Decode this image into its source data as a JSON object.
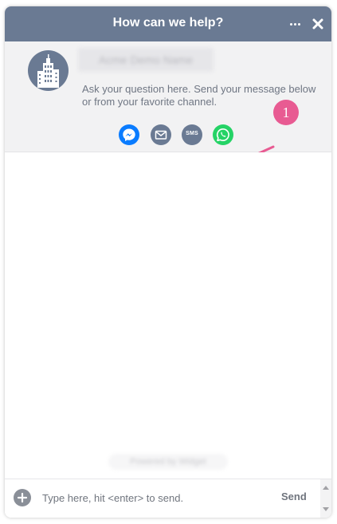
{
  "header": {
    "title": "How can we help?",
    "more_icon": "more-horizontal-icon",
    "close_icon": "close-icon",
    "color": "#6a7a93"
  },
  "intro": {
    "company_name": "Acme Demo Name",
    "avatar_icon": "building-icon",
    "message": "Ask your question here. Send your message below or from your favorite channel."
  },
  "channels": [
    {
      "name": "Messenger",
      "icon": "messenger-icon",
      "color": "#0a7cff"
    },
    {
      "name": "Email",
      "icon": "email-icon",
      "color": "#6a7a93"
    },
    {
      "name": "SMS",
      "icon": "sms-icon",
      "label": "SMS",
      "color": "#6a7a93"
    },
    {
      "name": "WhatsApp",
      "icon": "whatsapp-icon",
      "color": "#25d366"
    }
  ],
  "annotation": {
    "number": "1",
    "color": "#e85b92"
  },
  "footer": {
    "powered_by": "Powered by Widget"
  },
  "composer": {
    "attach_icon": "plus-icon",
    "placeholder": "Type here, hit <enter> to send.",
    "value": "",
    "send_label": "Send"
  }
}
